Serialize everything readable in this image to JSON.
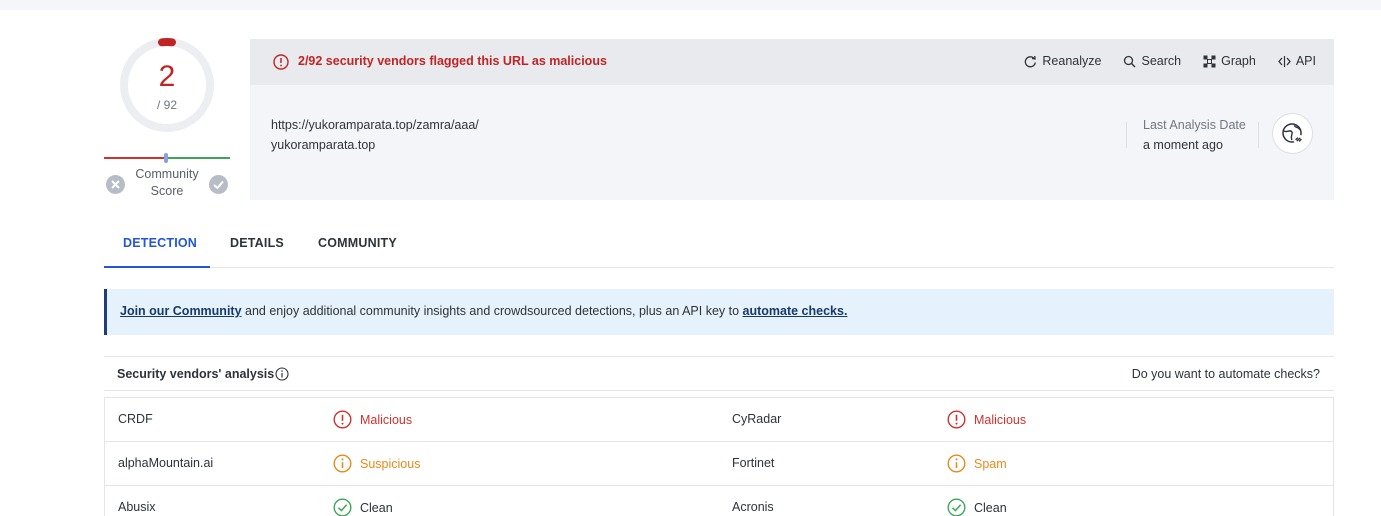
{
  "score": {
    "detections": "2",
    "total": "/ 92",
    "community_label_line1": "Community",
    "community_label_line2": "Score"
  },
  "header": {
    "alert": "2/92 security vendors flagged this URL as malicious",
    "actions": {
      "reanalyze": "Reanalyze",
      "search": "Search",
      "graph": "Graph",
      "api": "API"
    },
    "url": "https://yukoramparata.top/zamra/aaa/",
    "domain": "yukoramparata.top",
    "last_analysis_label": "Last Analysis Date",
    "last_analysis_value": "a moment ago"
  },
  "tabs": {
    "detection": "DETECTION",
    "details": "DETAILS",
    "community": "COMMUNITY"
  },
  "banner": {
    "link1": "Join our Community",
    "middle": " and enjoy additional community insights and crowdsourced detections, plus an API key to ",
    "link2": "automate checks."
  },
  "vendors": {
    "title": "Security vendors' analysis",
    "automate": "Do you want to automate checks?",
    "rows": [
      {
        "left_name": "CRDF",
        "left_result": "Malicious",
        "left_type": "malicious",
        "right_name": "CyRadar",
        "right_result": "Malicious",
        "right_type": "malicious"
      },
      {
        "left_name": "alphaMountain.ai",
        "left_result": "Suspicious",
        "left_type": "suspicious",
        "right_name": "Fortinet",
        "right_result": "Spam",
        "right_type": "suspicious"
      },
      {
        "left_name": "Abusix",
        "left_result": "Clean",
        "left_type": "clean",
        "right_name": "Acronis",
        "right_result": "Clean",
        "right_type": "clean"
      }
    ]
  },
  "colors": {
    "malicious": "#d0312d",
    "suspicious": "#e88a1a",
    "clean": "#3aa757",
    "accent": "#2256d6"
  }
}
